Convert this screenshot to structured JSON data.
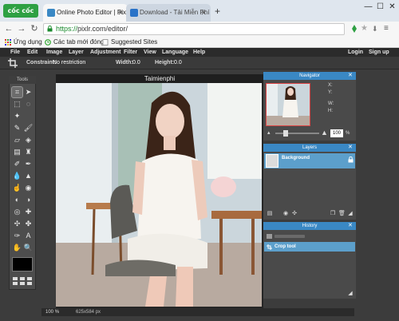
{
  "browser": {
    "logo": "cốc cốc",
    "tabs": [
      {
        "label": "Online Photo Editor | Pixl",
        "active": true
      },
      {
        "label": "Download - Tải Miễn Phí",
        "active": false
      }
    ],
    "new_tab": "+",
    "window_controls": {
      "minimize": "—",
      "maximize": "☐",
      "close": "✕"
    },
    "url_scheme": "https://",
    "url_rest": "pixlr.com/editor/",
    "bookmarks": [
      "Ứng dụng",
      "Các tab mới đóng",
      "Suggested Sites"
    ]
  },
  "app": {
    "menu_left": [
      "File",
      "Edit",
      "Image",
      "Layer",
      "Adjustment",
      "Filter",
      "View",
      "Language",
      "Help"
    ],
    "menu_right": [
      "Login",
      "Sign up"
    ],
    "options": {
      "constraint_label": "Constraint:",
      "constraint_value": "No restriction",
      "width_label": "Width:",
      "width_value": "0.0",
      "height_label": "Height:",
      "height_value": "0.0"
    },
    "tools_title": "Tools",
    "canvas_title": "Taimienphi",
    "status_zoom": "100",
    "status_zoom_unit": "%",
    "status_size": "625x584 px",
    "navigator": {
      "title": "Navigator",
      "x_label": "X:",
      "y_label": "Y:",
      "w_label": "W:",
      "h_label": "H:",
      "zoom_value": "100",
      "zoom_unit": "%"
    },
    "layers": {
      "title": "Layers",
      "items": [
        {
          "name": "Background",
          "locked": true
        }
      ]
    },
    "history": {
      "title": "History",
      "items": [
        {
          "label": "Crop tool",
          "selected": true
        }
      ]
    }
  },
  "colors": {
    "panel_header": "#3a88c4",
    "selected_row": "#5c9fcb",
    "url_green": "#1a8a2d",
    "coccoc_green": "#2ea043"
  }
}
